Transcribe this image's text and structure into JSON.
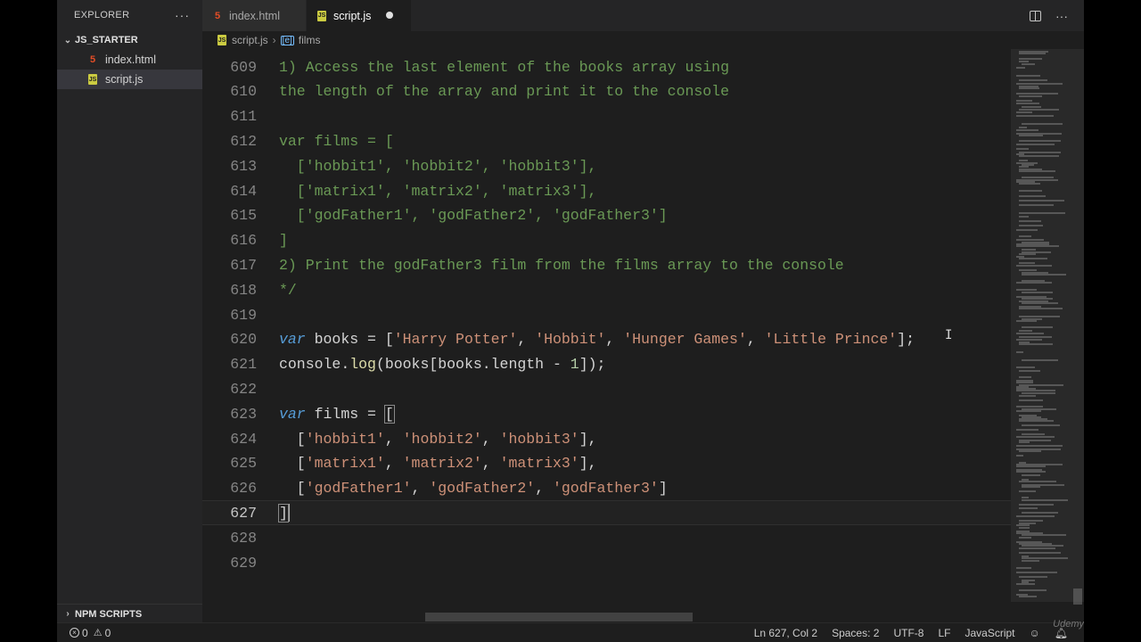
{
  "sidebar": {
    "title": "EXPLORER",
    "more": "···",
    "folder": "JS_STARTER",
    "files": [
      {
        "name": "index.html",
        "type": "html"
      },
      {
        "name": "script.js",
        "type": "js"
      }
    ],
    "npm": "NPM SCRIPTS"
  },
  "tabs": [
    {
      "name": "index.html",
      "type": "html"
    },
    {
      "name": "script.js",
      "type": "js"
    }
  ],
  "tab_more": "···",
  "breadcrumb": {
    "file": "script.js",
    "symbol": "films"
  },
  "editor": {
    "lines": [
      {
        "n": "609",
        "text": "1) Access the last element of the books array using"
      },
      {
        "n": "610",
        "text": "the length of the array and print it to the console"
      },
      {
        "n": "611",
        "text": ""
      },
      {
        "n": "612",
        "text": "var films = ["
      },
      {
        "n": "613",
        "text": "  ['hobbit1', 'hobbit2', 'hobbit3'],"
      },
      {
        "n": "614",
        "text": "  ['matrix1', 'matrix2', 'matrix3'],"
      },
      {
        "n": "615",
        "text": "  ['godFather1', 'godFather2', 'godFather3']"
      },
      {
        "n": "616",
        "text": "]"
      },
      {
        "n": "617",
        "text": "2) Print the godFather3 film from the films array to the console"
      },
      {
        "n": "618",
        "text": "*/"
      },
      {
        "n": "619",
        "text": ""
      },
      {
        "n": "620",
        "text": ""
      },
      {
        "n": "621",
        "text": ""
      },
      {
        "n": "622",
        "text": ""
      },
      {
        "n": "623",
        "text": ""
      },
      {
        "n": "624",
        "text": ""
      },
      {
        "n": "625",
        "text": ""
      },
      {
        "n": "626",
        "text": ""
      },
      {
        "n": "627",
        "text": ""
      },
      {
        "n": "628",
        "text": ""
      },
      {
        "n": "629",
        "text": ""
      }
    ],
    "books_kw": "var",
    "books_name": " books ",
    "books_eq": "= [",
    "books_items": [
      "'Harry Potter'",
      "'Hobbit'",
      "'Hunger Games'",
      "'Little Prince'"
    ],
    "books_end": "];",
    "log_obj": "console",
    "log_fn": "log",
    "log_arg_a": "(books[books.length ",
    "log_minus": "-",
    "log_num": "1",
    "log_end": "]);",
    "films_kw": "var",
    "films_name": " films ",
    "films_eq": "= ",
    "films_open": "[",
    "films_close": "]",
    "film_rows": [
      [
        "'hobbit1'",
        "'hobbit2'",
        "'hobbit3'"
      ],
      [
        "'matrix1'",
        "'matrix2'",
        "'matrix3'"
      ],
      [
        "'godFather1'",
        "'godFather2'",
        "'godFather3'"
      ]
    ]
  },
  "status": {
    "errors": "0",
    "warnings": "0",
    "position": "Ln 627, Col 2",
    "spaces": "Spaces: 2",
    "encoding": "UTF-8",
    "eol": "LF",
    "language": "JavaScript",
    "watermark": "Udemy"
  }
}
